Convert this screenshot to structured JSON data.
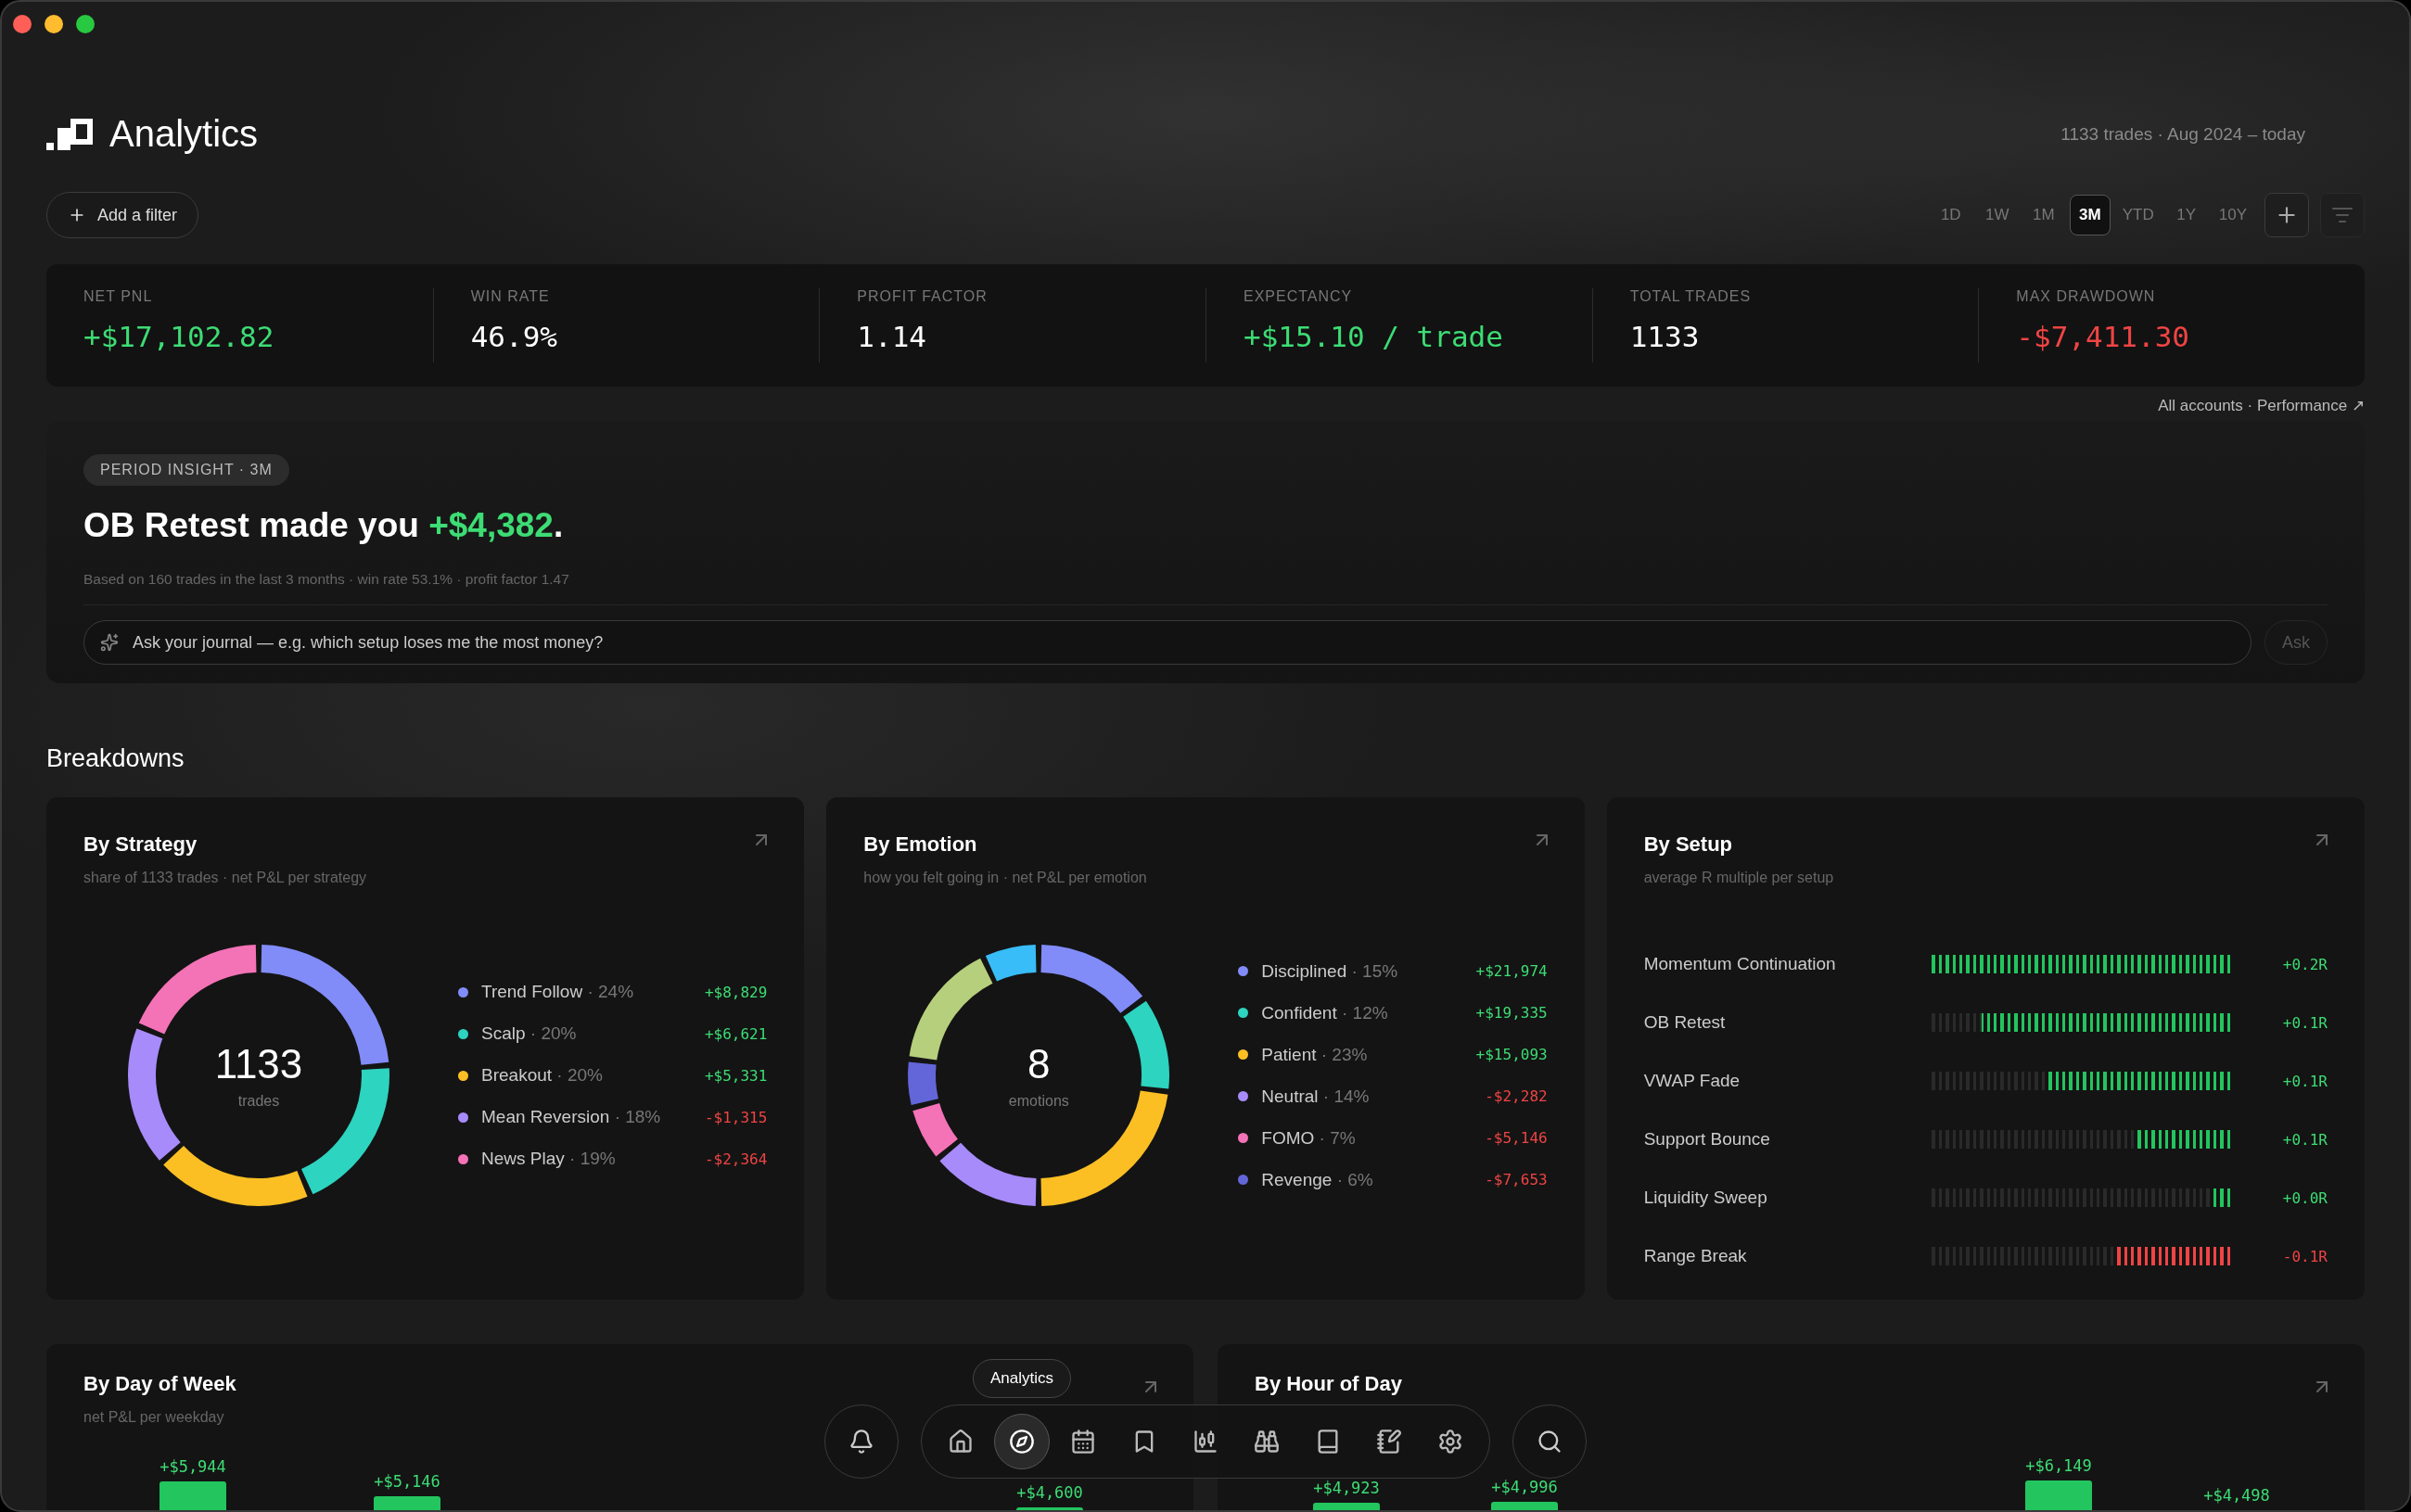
{
  "header": {
    "title": "Analytics",
    "meta": "1133 trades · Aug 2024 – today"
  },
  "filter_button": "Add a filter",
  "timeframes": [
    {
      "label": "1D",
      "selected": false
    },
    {
      "label": "1W",
      "selected": false
    },
    {
      "label": "1M",
      "selected": false
    },
    {
      "label": "3M",
      "selected": true
    },
    {
      "label": "YTD",
      "selected": false
    },
    {
      "label": "1Y",
      "selected": false
    },
    {
      "label": "10Y",
      "selected": false
    }
  ],
  "stats": [
    {
      "label": "NET PNL",
      "value": "+$17,102.82",
      "color": "#3ddc74"
    },
    {
      "label": "WIN RATE",
      "value": "46.9%",
      "color": "#ffffff"
    },
    {
      "label": "PROFIT FACTOR",
      "value": "1.14",
      "color": "#ffffff"
    },
    {
      "label": "EXPECTANCY",
      "value": "+$15.10 / trade",
      "color": "#3ddc74"
    },
    {
      "label": "TOTAL TRADES",
      "value": "1133",
      "color": "#ffffff"
    },
    {
      "label": "MAX DRAWDOWN",
      "value": "-$7,411.30",
      "color": "#ef4444"
    }
  ],
  "stats_link": "All accounts · Performance ↗",
  "insight": {
    "badge": "PERIOD INSIGHT · 3M",
    "headline": "OB Retest made you",
    "amount": "+$4,382",
    "period": ".",
    "detail": "Based on 160 trades in the last 3 months · win rate 53.1% · profit factor 1.47",
    "ask_placeholder": "Ask your journal — e.g. which setup loses me the most money?",
    "ask_button": "Ask"
  },
  "breakdowns_title": "Breakdowns",
  "strategy": {
    "title": "By Strategy",
    "subtitle": "share of 1133 trades · net P&L per strategy",
    "center_value": "1133",
    "center_label": "trades",
    "chart_data": {
      "type": "donut",
      "values": [
        24,
        20,
        20,
        18,
        19
      ],
      "colors": [
        "#818cf8",
        "#2dd4bf",
        "#fbbf24",
        "#a78bfa",
        "#f472b6"
      ]
    },
    "legend": [
      {
        "name": "Trend Follow",
        "share": "· 24%",
        "pnl": "+$8,829",
        "negative": false,
        "color": "#818cf8"
      },
      {
        "name": "Scalp",
        "share": "· 20%",
        "pnl": "+$6,621",
        "negative": false,
        "color": "#2dd4bf"
      },
      {
        "name": "Breakout",
        "share": "· 20%",
        "pnl": "+$5,331",
        "negative": false,
        "color": "#fbbf24"
      },
      {
        "name": "Mean Reversion",
        "share": "· 18%",
        "pnl": "-$1,315",
        "negative": true,
        "color": "#a78bfa"
      },
      {
        "name": "News Play",
        "share": "· 19%",
        "pnl": "-$2,364",
        "negative": true,
        "color": "#f472b6"
      }
    ]
  },
  "emotion": {
    "title": "By Emotion",
    "subtitle": "how you felt going in · net P&L per emotion",
    "center_value": "8",
    "center_label": "emotions",
    "chart_data": {
      "type": "donut",
      "values": [
        15,
        12,
        23,
        14,
        7,
        6,
        16,
        7
      ],
      "colors": [
        "#818cf8",
        "#2dd4bf",
        "#fbbf24",
        "#a78bfa",
        "#f472b6",
        "#6366d8",
        "#b6cf7c",
        "#38bdf8"
      ]
    },
    "legend": [
      {
        "name": "Disciplined",
        "share": "· 15%",
        "pnl": "+$21,974",
        "negative": false,
        "color": "#818cf8"
      },
      {
        "name": "Confident",
        "share": "· 12%",
        "pnl": "+$19,335",
        "negative": false,
        "color": "#2dd4bf"
      },
      {
        "name": "Patient",
        "share": "· 23%",
        "pnl": "+$15,093",
        "negative": false,
        "color": "#fbbf24"
      },
      {
        "name": "Neutral",
        "share": "· 14%",
        "pnl": "-$2,282",
        "negative": true,
        "color": "#a78bfa"
      },
      {
        "name": "FOMO",
        "share": "· 7%",
        "pnl": "-$5,146",
        "negative": true,
        "color": "#f472b6"
      },
      {
        "name": "Revenge",
        "share": "· 6%",
        "pnl": "-$7,653",
        "negative": true,
        "color": "#6366d8"
      }
    ]
  },
  "setup": {
    "title": "By Setup",
    "subtitle": "average R multiple per setup",
    "rows": [
      {
        "name": "Momentum Continuation",
        "level": 1.0,
        "value": "+0.2R",
        "negative": false
      },
      {
        "name": "OB Retest",
        "level": 0.83,
        "value": "+0.1R",
        "negative": false
      },
      {
        "name": "VWAP Fade",
        "level": 0.62,
        "value": "+0.1R",
        "negative": false
      },
      {
        "name": "Support Bounce",
        "level": 0.31,
        "value": "+0.1R",
        "negative": false
      },
      {
        "name": "Liquidity Sweep",
        "level": 0.06,
        "value": "+0.0R",
        "negative": false
      },
      {
        "name": "Range Break",
        "level": 0.38,
        "value": "-0.1R",
        "negative": true
      }
    ]
  },
  "day_of_week": {
    "title": "By Day of Week",
    "subtitle": "net P&L per weekday",
    "bar_labels": [
      "+$5,944",
      "+$5,146",
      "+$4,600"
    ]
  },
  "hour_of_day": {
    "title": "By Hour of Day",
    "bar_labels": [
      "+$4,923",
      "+$4,996",
      "+$6,149",
      "+$4,498"
    ]
  },
  "dock": {
    "tooltip": "Analytics",
    "items": [
      {
        "selected": false
      },
      {
        "selected": true
      },
      {
        "selected": false
      },
      {
        "selected": false
      },
      {
        "selected": false
      },
      {
        "selected": false
      },
      {
        "selected": false
      },
      {
        "selected": false
      },
      {
        "selected": false
      }
    ]
  }
}
